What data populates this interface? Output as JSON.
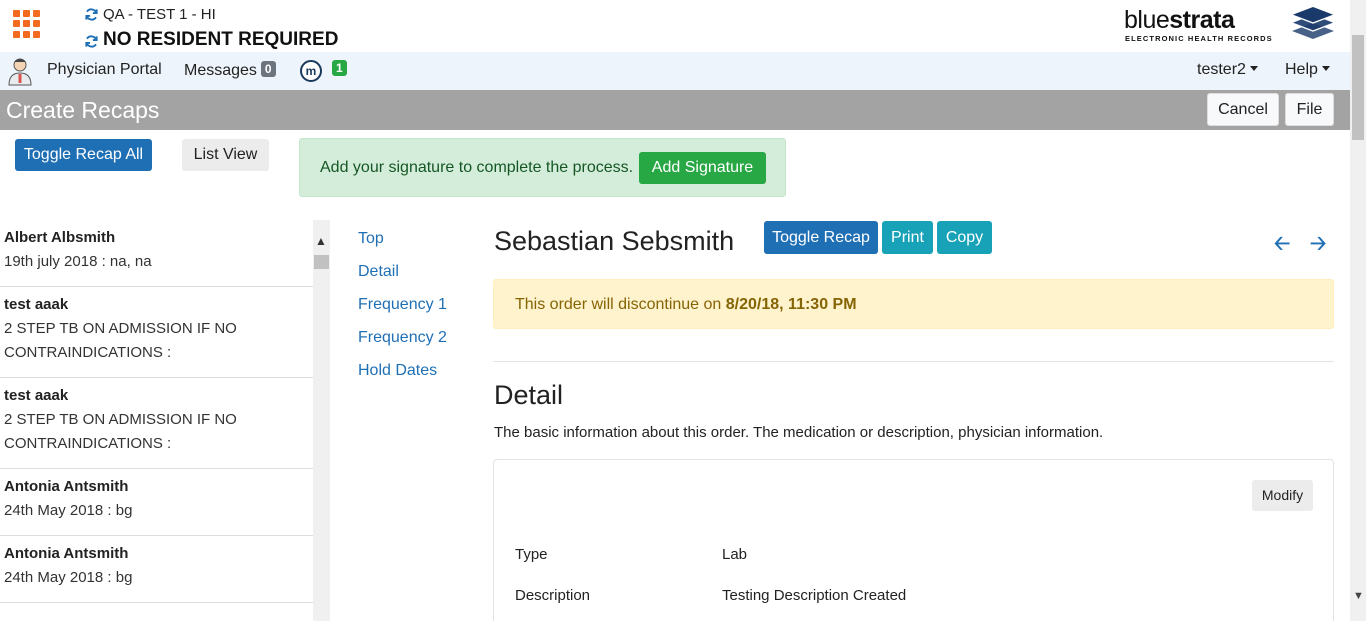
{
  "header": {
    "facility": "QA - TEST 1 - HI",
    "resident": "NO RESIDENT REQUIRED",
    "logo_thin": "blue",
    "logo_bold": "strata",
    "logo_subtitle": "ELECTRONIC HEALTH RECORDS"
  },
  "nav": {
    "physician_portal": "Physician Portal",
    "messages": "Messages",
    "messages_count": "0",
    "m_label": "m",
    "m_count": "1",
    "user": "tester2",
    "help": "Help"
  },
  "titlebar": {
    "title": "Create Recaps",
    "cancel": "Cancel",
    "file": "File"
  },
  "actions": {
    "toggle_all": "Toggle Recap All",
    "list_view": "List View",
    "signature_msg": "Add your signature to complete the process.",
    "add_signature": "Add Signature"
  },
  "recap_list": [
    {
      "name": "Albert Albsmith",
      "detail": "19th july 2018 : na, na"
    },
    {
      "name": "test aaak",
      "detail": "2 STEP TB ON ADMISSION IF NO CONTRAINDICATIONS :"
    },
    {
      "name": "test aaak",
      "detail": "2 STEP TB ON ADMISSION IF NO CONTRAINDICATIONS :"
    },
    {
      "name": "Antonia Antsmith",
      "detail": "24th May 2018 : bg"
    },
    {
      "name": "Antonia Antsmith",
      "detail": "24th May 2018 : bg"
    }
  ],
  "anchors": [
    "Top",
    "Detail",
    "Frequency 1",
    "Frequency 2",
    "Hold Dates"
  ],
  "order": {
    "patient_name": "Sebastian Sebsmith",
    "toggle_recap": "Toggle Recap",
    "print": "Print",
    "copy": "Copy",
    "discontinue_prefix": "This order will discontinue on",
    "discontinue_date": "8/20/18, 11:30 PM"
  },
  "detail": {
    "title": "Detail",
    "description": "The basic information about this order. The medication or description, physician information.",
    "modify": "Modify",
    "type_label": "Type",
    "type_value": "Lab",
    "desc_label": "Description",
    "desc_value": "Testing Description Created"
  },
  "colors": {
    "primary": "#1f6fb5",
    "success": "#28a745",
    "info": "#17a2b8",
    "titlebar": "#a3a3a3",
    "brand_orange": "#f26b21"
  }
}
